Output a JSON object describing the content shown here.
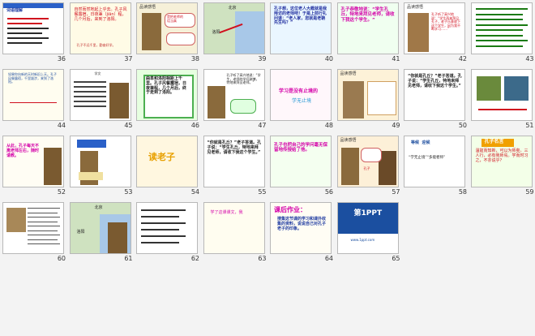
{
  "slides": [
    {
      "num": "36",
      "label": "词语理解"
    },
    {
      "num": "37",
      "text": "自然而然地起上乎去。孔子风餐露宿，日夜兼（jiān）程，几个月后，来到了洛阳。",
      "footer": "孔子不远千里，勤奋好学。"
    },
    {
      "num": "38",
      "label": "品读感悟",
      "bubble": "是把老师的\n话当真"
    },
    {
      "num": "39",
      "map_labels": [
        "北京",
        "洛阳"
      ]
    },
    {
      "num": "40",
      "text": "孔子想，这位老人大概就是我拜访的老师吧！于是上前行礼问道：“老人家，您就是老聃先生吗？”"
    },
    {
      "num": "41",
      "text": "孔子恭敬地说：“学生孔丘，特地来拜见老师，请收下我这个学生。”"
    },
    {
      "num": "42",
      "label": "品读感悟",
      "text": "孔子听了高兴地说：“学生再来拜见孔子，老子乐意收下这个学生，因为我不断学习……”"
    },
    {
      "num": "43"
    },
    {
      "num": "44",
      "text": "如果你向新的天时新旧上天。孔子风餐露宿，千里跋涉，来到了洛阳。"
    },
    {
      "num": "45",
      "label": "学文"
    },
    {
      "num": "46",
      "text": "曲阜和洛阳相距上千里。孔子风餐露宿，日夜兼程，几个月后，终于走到了洛阳。"
    },
    {
      "num": "47",
      "text": "孔子听了高兴地说：“学生，老师的学问渊博，特地来拜见老师。”"
    },
    {
      "num": "48",
      "text": "学习是没有止境的",
      "sub": "学无止境"
    },
    {
      "num": "49",
      "label": "品读感悟"
    },
    {
      "num": "50",
      "text": "“你就是孔丘？”老子答道。孔子说：“学生孔丘，特地来拜见老师，请收下我这个学生。”"
    },
    {
      "num": "51"
    },
    {
      "num": "52",
      "text": "从此，孔子每天不离老师左右，随时请教。",
      "footer": "谦虚好学"
    },
    {
      "num": "53",
      "title": "孔子拜师"
    },
    {
      "num": "54",
      "title": "读老子"
    },
    {
      "num": "55",
      "text": "“你就是孔丘？”老子答道。孔子说：“学生孔丘，特地来拜见老师，请收下我这个学生。”"
    },
    {
      "num": "56",
      "text": "孔子也把自己的学问毫无保留地传授给了他。"
    },
    {
      "num": "57",
      "label": "品读感悟",
      "sub": "孔子"
    },
    {
      "num": "58",
      "text": "等候  迎候",
      "sub": "“学无止境”“多能者师”"
    },
    {
      "num": "59",
      "title": "孔子名言",
      "text": "温故而知新，可以为师矣。三人行，必有我师焉。学而时习之，不亦说乎？"
    },
    {
      "num": "60"
    },
    {
      "num": "61",
      "map_labels": [
        "北京",
        "洛阳"
      ]
    },
    {
      "num": "62"
    },
    {
      "num": "63",
      "text": "学了这课课文，我"
    },
    {
      "num": "64",
      "title": "课后作业：",
      "text": "搜集这节课的学习和课外收集的资料，说说自己对孔子老子的印象。"
    },
    {
      "num": "65",
      "logo": "第1PPT",
      "sub": "www.1ppt.com"
    }
  ],
  "colors": {
    "accent_red": "#d0101e",
    "accent_magenta": "#d400a8",
    "accent_green": "#1a7a12",
    "accent_blue": "#1e3aa0",
    "thumb_border": "#b8b8b8"
  }
}
